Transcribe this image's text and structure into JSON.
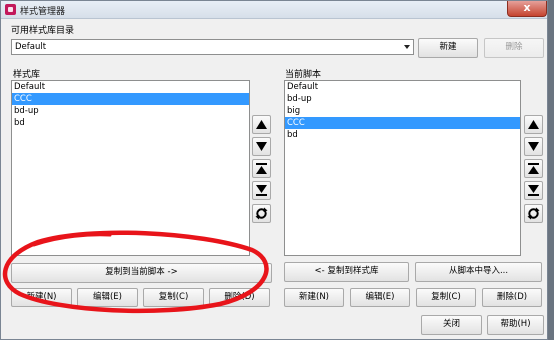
{
  "window": {
    "title": "样式管理器",
    "close_label": "x"
  },
  "top": {
    "dir_label": "可用样式库目录",
    "combo_value": "Default",
    "new_button": "新建",
    "delete_button": "删除"
  },
  "left": {
    "label": "样式库",
    "items": [
      {
        "name": "Default",
        "selected": false
      },
      {
        "name": "CCC",
        "selected": true
      },
      {
        "name": "bd-up",
        "selected": false
      },
      {
        "name": "bd",
        "selected": false
      }
    ],
    "copy_button": "复制到当前脚本 ->",
    "new_button": "新建(N)",
    "edit_button": "编辑(E)",
    "dup_button": "复制(C)",
    "delete_button": "删除(D)"
  },
  "right": {
    "label": "当前脚本",
    "items": [
      {
        "name": "Default",
        "selected": false
      },
      {
        "name": "bd-up",
        "selected": false
      },
      {
        "name": "big",
        "selected": false
      },
      {
        "name": "CCC",
        "selected": true
      },
      {
        "name": "bd",
        "selected": false
      }
    ],
    "copy_button": "<- 复制到样式库",
    "import_button": "从脚本中导入...",
    "new_button": "新建(N)",
    "edit_button": "编辑(E)",
    "dup_button": "复制(C)",
    "delete_button": "删除(D)"
  },
  "footer": {
    "close_button": "关闭",
    "help_button": "帮助(H)"
  },
  "side_icons": [
    "move-up-icon",
    "move-down-icon",
    "move-top-icon",
    "move-bottom-icon",
    "sort-icon"
  ],
  "colors": {
    "selection": "#3399ff",
    "annotation": "#e8141a"
  }
}
